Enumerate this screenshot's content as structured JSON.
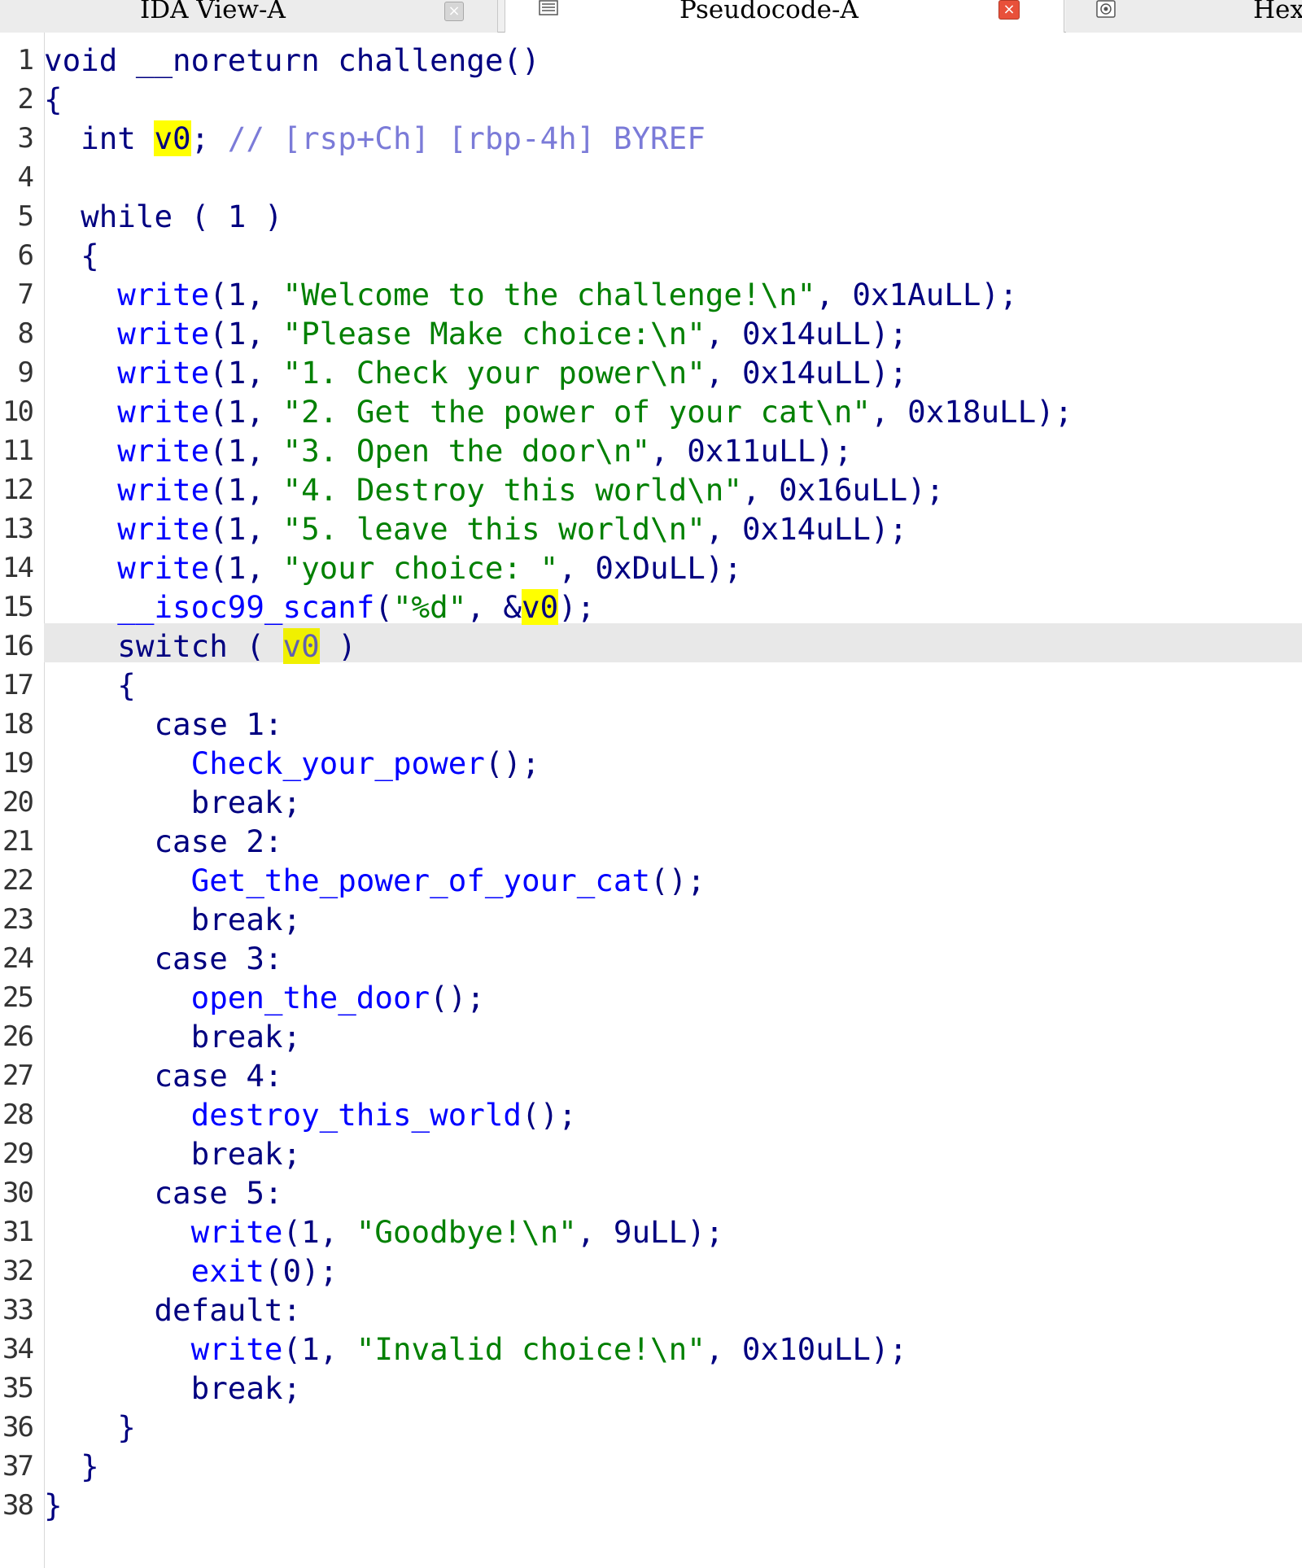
{
  "tabs": {
    "ida_view": {
      "label": "IDA View-A",
      "close": "×"
    },
    "pseudocode": {
      "label": "Pseudocode-A",
      "close": "×"
    },
    "hex": {
      "label": "Hex"
    }
  },
  "colors": {
    "keyword": "#000080",
    "function": "#0000ff",
    "string": "#008000",
    "comment": "#7b7bd8",
    "highlight": "#ffff00",
    "current_line": "#e8e8e8"
  },
  "current_line_number": 16,
  "lines": [
    {
      "n": "1",
      "tokens": [
        [
          "kw",
          "void __noreturn challenge()"
        ]
      ]
    },
    {
      "n": "2",
      "tokens": [
        [
          "punc",
          "{"
        ]
      ]
    },
    {
      "n": "3",
      "tokens": [
        [
          "kw",
          "  int "
        ],
        [
          "hl",
          "v0"
        ],
        [
          "punc",
          "; "
        ],
        [
          "cmt",
          "// [rsp+Ch] [rbp-4h] BYREF"
        ]
      ]
    },
    {
      "n": "4",
      "tokens": []
    },
    {
      "n": "5",
      "tokens": [
        [
          "kw",
          "  while ( 1 )"
        ]
      ]
    },
    {
      "n": "6",
      "tokens": [
        [
          "punc",
          "  {"
        ]
      ]
    },
    {
      "n": "7",
      "tokens": [
        [
          "fn",
          "    write"
        ],
        [
          "punc",
          "(1, "
        ],
        [
          "str",
          "\"Welcome to the challenge!\\n\""
        ],
        [
          "punc",
          ", 0x1AuLL);"
        ]
      ]
    },
    {
      "n": "8",
      "tokens": [
        [
          "fn",
          "    write"
        ],
        [
          "punc",
          "(1, "
        ],
        [
          "str",
          "\"Please Make choice:\\n\""
        ],
        [
          "punc",
          ", 0x14uLL);"
        ]
      ]
    },
    {
      "n": "9",
      "tokens": [
        [
          "fn",
          "    write"
        ],
        [
          "punc",
          "(1, "
        ],
        [
          "str",
          "\"1. Check your power\\n\""
        ],
        [
          "punc",
          ", 0x14uLL);"
        ]
      ]
    },
    {
      "n": "10",
      "tokens": [
        [
          "fn",
          "    write"
        ],
        [
          "punc",
          "(1, "
        ],
        [
          "str",
          "\"2. Get the power of your cat\\n\""
        ],
        [
          "punc",
          ", 0x18uLL);"
        ]
      ]
    },
    {
      "n": "11",
      "tokens": [
        [
          "fn",
          "    write"
        ],
        [
          "punc",
          "(1, "
        ],
        [
          "str",
          "\"3. Open the door\\n\""
        ],
        [
          "punc",
          ", 0x11uLL);"
        ]
      ]
    },
    {
      "n": "12",
      "tokens": [
        [
          "fn",
          "    write"
        ],
        [
          "punc",
          "(1, "
        ],
        [
          "str",
          "\"4. Destroy this world\\n\""
        ],
        [
          "punc",
          ", 0x16uLL);"
        ]
      ]
    },
    {
      "n": "13",
      "tokens": [
        [
          "fn",
          "    write"
        ],
        [
          "punc",
          "(1, "
        ],
        [
          "str",
          "\"5. leave this world\\n\""
        ],
        [
          "punc",
          ", 0x14uLL);"
        ]
      ]
    },
    {
      "n": "14",
      "tokens": [
        [
          "fn",
          "    write"
        ],
        [
          "punc",
          "(1, "
        ],
        [
          "str",
          "\"your choice: \""
        ],
        [
          "punc",
          ", 0xDuLL);"
        ]
      ]
    },
    {
      "n": "15",
      "tokens": [
        [
          "fn",
          "    __isoc99_scanf"
        ],
        [
          "punc",
          "("
        ],
        [
          "str",
          "\"%d\""
        ],
        [
          "punc",
          ", &"
        ],
        [
          "hl",
          "v0"
        ],
        [
          "punc",
          ");"
        ]
      ]
    },
    {
      "n": "16",
      "tokens": [
        [
          "kw",
          "    switch ( "
        ],
        [
          "hldim",
          "v0"
        ],
        [
          "kw",
          " )"
        ]
      ]
    },
    {
      "n": "17",
      "tokens": [
        [
          "punc",
          "    {"
        ]
      ]
    },
    {
      "n": "18",
      "tokens": [
        [
          "kw",
          "      case 1:"
        ]
      ]
    },
    {
      "n": "19",
      "tokens": [
        [
          "fn",
          "        Check_your_power"
        ],
        [
          "punc",
          "();"
        ]
      ]
    },
    {
      "n": "20",
      "tokens": [
        [
          "kw",
          "        break;"
        ]
      ]
    },
    {
      "n": "21",
      "tokens": [
        [
          "kw",
          "      case 2:"
        ]
      ]
    },
    {
      "n": "22",
      "tokens": [
        [
          "fn",
          "        Get_the_power_of_your_cat"
        ],
        [
          "punc",
          "();"
        ]
      ]
    },
    {
      "n": "23",
      "tokens": [
        [
          "kw",
          "        break;"
        ]
      ]
    },
    {
      "n": "24",
      "tokens": [
        [
          "kw",
          "      case 3:"
        ]
      ]
    },
    {
      "n": "25",
      "tokens": [
        [
          "fn",
          "        open_the_door"
        ],
        [
          "punc",
          "();"
        ]
      ]
    },
    {
      "n": "26",
      "tokens": [
        [
          "kw",
          "        break;"
        ]
      ]
    },
    {
      "n": "27",
      "tokens": [
        [
          "kw",
          "      case 4:"
        ]
      ]
    },
    {
      "n": "28",
      "tokens": [
        [
          "fn",
          "        destroy_this_world"
        ],
        [
          "punc",
          "();"
        ]
      ]
    },
    {
      "n": "29",
      "tokens": [
        [
          "kw",
          "        break;"
        ]
      ]
    },
    {
      "n": "30",
      "tokens": [
        [
          "kw",
          "      case 5:"
        ]
      ]
    },
    {
      "n": "31",
      "tokens": [
        [
          "fn",
          "        write"
        ],
        [
          "punc",
          "(1, "
        ],
        [
          "str",
          "\"Goodbye!\\n\""
        ],
        [
          "punc",
          ", 9uLL);"
        ]
      ]
    },
    {
      "n": "32",
      "tokens": [
        [
          "fn",
          "        exit"
        ],
        [
          "punc",
          "(0);"
        ]
      ]
    },
    {
      "n": "33",
      "tokens": [
        [
          "kw",
          "      default:"
        ]
      ]
    },
    {
      "n": "34",
      "tokens": [
        [
          "fn",
          "        write"
        ],
        [
          "punc",
          "(1, "
        ],
        [
          "str",
          "\"Invalid choice!\\n\""
        ],
        [
          "punc",
          ", 0x10uLL);"
        ]
      ]
    },
    {
      "n": "35",
      "tokens": [
        [
          "kw",
          "        break;"
        ]
      ]
    },
    {
      "n": "36",
      "tokens": [
        [
          "punc",
          "    }"
        ]
      ]
    },
    {
      "n": "37",
      "tokens": [
        [
          "punc",
          "  }"
        ]
      ]
    },
    {
      "n": "38",
      "tokens": [
        [
          "punc",
          "}"
        ]
      ]
    }
  ]
}
